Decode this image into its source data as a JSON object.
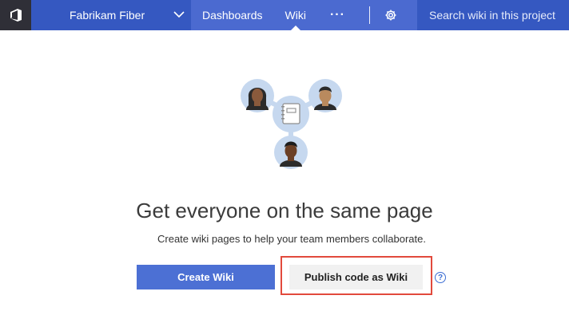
{
  "header": {
    "logo_icon": "azure-devops-logo-icon",
    "project_name": "Fabrikam Fiber",
    "project_dropdown_icon": "chevron-down-icon",
    "nav": [
      {
        "label": "Dashboards",
        "active": false
      },
      {
        "label": "Wiki",
        "active": true
      }
    ],
    "more_icon": "ellipsis-icon",
    "more_label": "···",
    "settings_icon": "gear-icon",
    "search_placeholder": "Search wiki in this project"
  },
  "main": {
    "illustration_icon": "team-wiki-illustration",
    "title": "Get everyone on the same page",
    "subtitle": "Create wiki pages to help your team members collaborate.",
    "create_button": "Create Wiki",
    "publish_button": "Publish code as Wiki",
    "help_icon": "help-circle-icon",
    "help_label": "?"
  },
  "colors": {
    "header_bg": "#3c5cc4",
    "primary_button": "#4c70d4",
    "highlight_border": "#e24a3c"
  }
}
